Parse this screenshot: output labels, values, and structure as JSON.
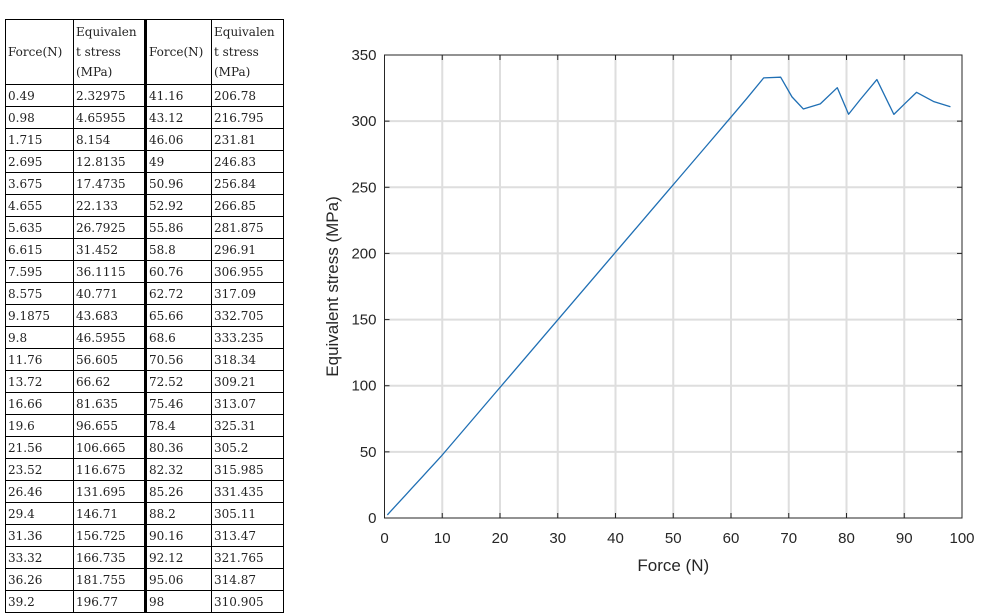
{
  "table": {
    "headers": {
      "force": "Force(N)",
      "stress_lines": [
        "Equivalen",
        "t stress",
        "(MPa)"
      ]
    },
    "left_rows": [
      [
        "0.49",
        "2.32975"
      ],
      [
        "0.98",
        "4.65955"
      ],
      [
        "1.715",
        "8.154"
      ],
      [
        "2.695",
        "12.8135"
      ],
      [
        "3.675",
        "17.4735"
      ],
      [
        "4.655",
        "22.133"
      ],
      [
        "5.635",
        "26.7925"
      ],
      [
        "6.615",
        "31.452"
      ],
      [
        "7.595",
        "36.1115"
      ],
      [
        "8.575",
        "40.771"
      ],
      [
        "9.1875",
        "43.683"
      ],
      [
        "9.8",
        "46.5955"
      ],
      [
        "11.76",
        "56.605"
      ],
      [
        "13.72",
        "66.62"
      ],
      [
        "16.66",
        "81.635"
      ],
      [
        "19.6",
        "96.655"
      ],
      [
        "21.56",
        "106.665"
      ],
      [
        "23.52",
        "116.675"
      ],
      [
        "26.46",
        "131.695"
      ],
      [
        "29.4",
        "146.71"
      ],
      [
        "31.36",
        "156.725"
      ],
      [
        "33.32",
        "166.735"
      ],
      [
        "36.26",
        "181.755"
      ],
      [
        "39.2",
        "196.77"
      ]
    ],
    "right_rows": [
      [
        "41.16",
        "206.78"
      ],
      [
        "43.12",
        "216.795"
      ],
      [
        "46.06",
        "231.81"
      ],
      [
        "49",
        "246.83"
      ],
      [
        "50.96",
        "256.84"
      ],
      [
        "52.92",
        "266.85"
      ],
      [
        "55.86",
        "281.875"
      ],
      [
        "58.8",
        "296.91"
      ],
      [
        "60.76",
        "306.955"
      ],
      [
        "62.72",
        "317.09"
      ],
      [
        "65.66",
        "332.705"
      ],
      [
        "68.6",
        "333.235"
      ],
      [
        "70.56",
        "318.34"
      ],
      [
        "72.52",
        "309.21"
      ],
      [
        "75.46",
        "313.07"
      ],
      [
        "78.4",
        "325.31"
      ],
      [
        "80.36",
        "305.2"
      ],
      [
        "82.32",
        "315.985"
      ],
      [
        "85.26",
        "331.435"
      ],
      [
        "88.2",
        "305.11"
      ],
      [
        "90.16",
        "313.47"
      ],
      [
        "92.12",
        "321.765"
      ],
      [
        "95.06",
        "314.87"
      ],
      [
        "98",
        "310.905"
      ]
    ]
  },
  "chart_data": {
    "type": "line",
    "title": "",
    "xlabel": "Force (N)",
    "ylabel": "Equivalent stress (MPa)",
    "xlim": [
      0,
      100
    ],
    "ylim": [
      0,
      350
    ],
    "xticks": [
      0,
      10,
      20,
      30,
      40,
      50,
      60,
      70,
      80,
      90,
      100
    ],
    "yticks": [
      0,
      50,
      100,
      150,
      200,
      250,
      300,
      350
    ],
    "grid": true,
    "line_color": "#1f6fb4",
    "series": [
      {
        "name": "Equivalent stress",
        "x": [
          0.49,
          0.98,
          1.715,
          2.695,
          3.675,
          4.655,
          5.635,
          6.615,
          7.595,
          8.575,
          9.1875,
          9.8,
          11.76,
          13.72,
          16.66,
          19.6,
          21.56,
          23.52,
          26.46,
          29.4,
          31.36,
          33.32,
          36.26,
          39.2,
          41.16,
          43.12,
          46.06,
          49,
          50.96,
          52.92,
          55.86,
          58.8,
          60.76,
          62.72,
          65.66,
          68.6,
          70.56,
          72.52,
          75.46,
          78.4,
          80.36,
          82.32,
          85.26,
          88.2,
          90.16,
          92.12,
          95.06,
          98
        ],
        "y": [
          2.32975,
          4.65955,
          8.154,
          12.8135,
          17.4735,
          22.133,
          26.7925,
          31.452,
          36.1115,
          40.771,
          43.683,
          46.5955,
          56.605,
          66.62,
          81.635,
          96.655,
          106.665,
          116.675,
          131.695,
          146.71,
          156.725,
          166.735,
          181.755,
          196.77,
          206.78,
          216.795,
          231.81,
          246.83,
          256.84,
          266.85,
          281.875,
          296.91,
          306.955,
          317.09,
          332.705,
          333.235,
          318.34,
          309.21,
          313.07,
          325.31,
          305.2,
          315.985,
          331.435,
          305.11,
          313.47,
          321.765,
          314.87,
          310.905
        ]
      }
    ]
  }
}
